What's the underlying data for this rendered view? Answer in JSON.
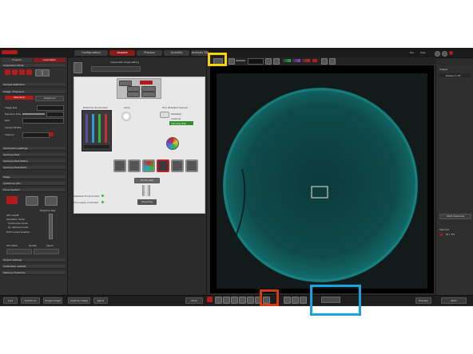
{
  "window": {
    "app_label": "",
    "tabs": [
      "Configuration",
      "Acquire",
      "Process",
      "Quantify",
      "Analysis 3D"
    ],
    "active_tab": "Acquire",
    "right_menu": [
      "File",
      "Help"
    ]
  },
  "left_panel": {
    "tabs": [
      "Projects",
      "Acquisition"
    ],
    "sections": [
      "Acquisition Mode",
      "Sample Definition",
      "Image / Exposure",
      "Illumination settings",
      "Spinning Disk",
      "Spinning Disk Status",
      "Spinning Disk Motor",
      "Stage",
      "Autofocus (AF)",
      "Focus System",
      "Project settings",
      "Calibration wizards",
      "Memory Functions"
    ],
    "exposure_tabs": [
      "Standard",
      "Advanced"
    ],
    "labels": [
      "Image Size",
      "Exposure time",
      "Gain",
      "Camera Profile",
      "Channel"
    ],
    "focus_labels": [
      "Objective Res",
      "AFC On/Off",
      "Operation mode",
      "Continuous mode",
      "On demand mode",
      "Hold current position"
    ],
    "af_mode_label": "AFC Mode",
    "af_mode_options": [
      "Quality",
      "Speed"
    ]
  },
  "center_panel": {
    "light_path_title": "Laser/Laser single setting",
    "sections": [
      "Multicolor Illumination",
      "Lamp",
      "Fluo Widefield Camera"
    ],
    "camera_options": [
      "Widefield",
      "Confocal",
      "Spinning Disk"
    ],
    "status": [
      "Adaptive Focus Control",
      "Time-Lapse controlled"
    ],
    "objective_label": "HC PL APO",
    "objective_name": "Objective"
  },
  "right_panel": {
    "header": "Images",
    "image_item": "Position 1 TIF",
    "btn_start_overview": "Start Overview",
    "task_header": "Task List",
    "task_item": "ID 1 TIS"
  },
  "bottom_bar": {
    "left_buttons": [
      "Live",
      "Autofocus",
      "Single image",
      "Capture image",
      "Spiral"
    ],
    "center_button": "Mark",
    "grey_field": "",
    "right_buttons": [
      "Preview",
      "Start"
    ]
  },
  "colors": {
    "accent_red": "#b01c1c",
    "highlight_yellow": "#f5d400",
    "highlight_red": "#d13a12",
    "highlight_blue": "#1aa3e0",
    "image_cyan": "#1a8c8c"
  }
}
